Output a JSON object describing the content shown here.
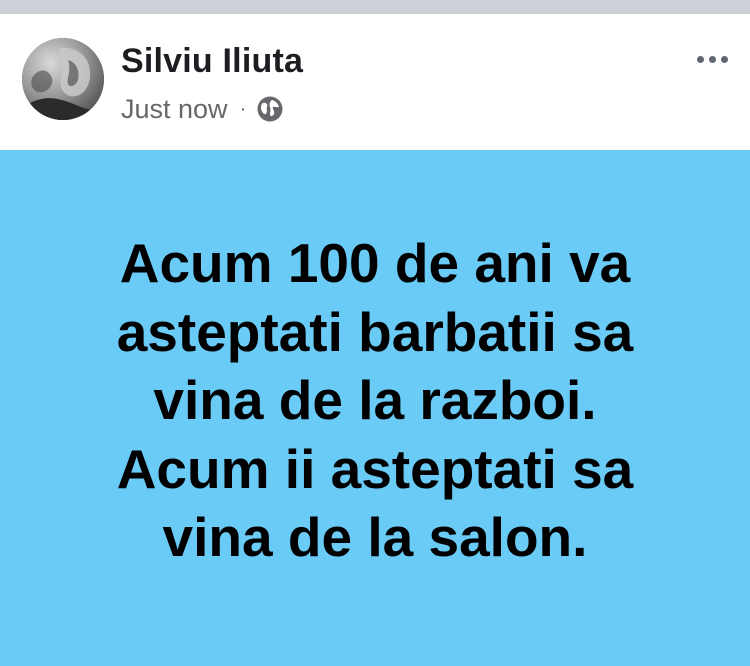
{
  "post": {
    "author_name": "Silviu Iliuta",
    "timestamp": "Just now",
    "separator": "·",
    "privacy_icon": "globe-icon",
    "more_icon": "more-horizontal-icon",
    "avatar_icon": "avatar-photo",
    "background_color": "#69cbf6",
    "text_lines": [
      "Acum 100 de ani va",
      "asteptati barbatii sa",
      "vina de la razboi.",
      "Acum ii asteptati sa",
      "vina de la salon."
    ]
  }
}
